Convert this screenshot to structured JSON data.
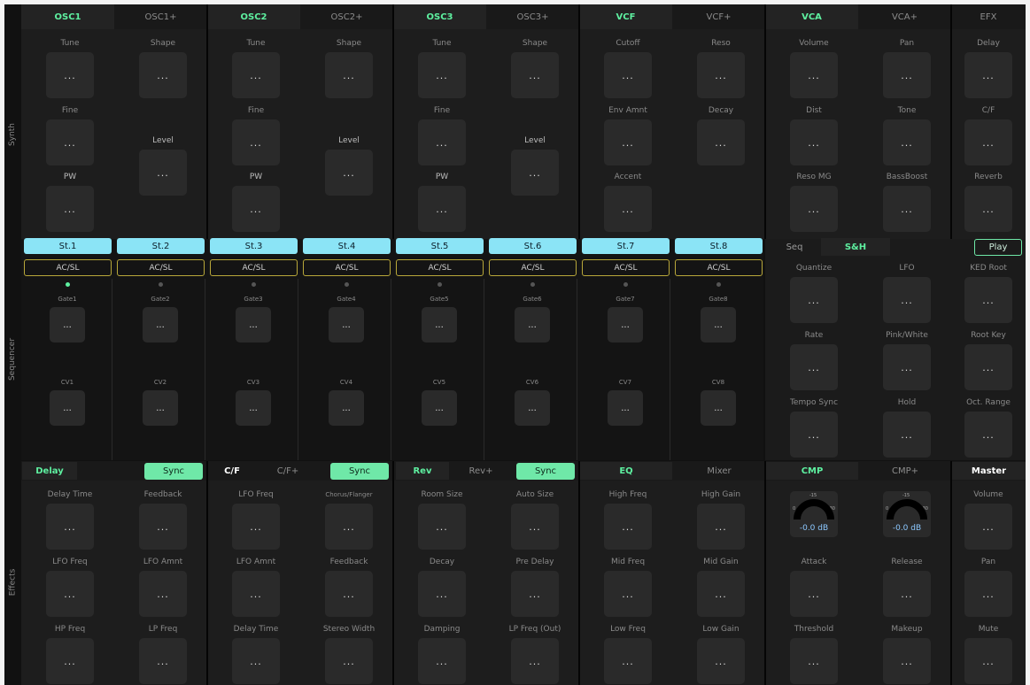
{
  "side_labels": {
    "synth": "Synth",
    "sequencer": "Sequencer",
    "effects": "Effects"
  },
  "tabs_top": [
    {
      "a": "OSC1",
      "b": "OSC1+"
    },
    {
      "a": "OSC2",
      "b": "OSC2+"
    },
    {
      "a": "OSC3",
      "b": "OSC3+"
    },
    {
      "a": "VCF",
      "b": "VCF+"
    },
    {
      "a": "VCA",
      "b": "VCA+"
    },
    {
      "a": "EFX"
    }
  ],
  "synth": {
    "osc1": {
      "k1": "Tune",
      "k2": "Shape",
      "k3": "Fine",
      "k4": "Level",
      "k5": "PW"
    },
    "osc2": {
      "k1": "Tune",
      "k2": "Shape",
      "k3": "Fine",
      "k4": "Level",
      "k5": "PW"
    },
    "osc3": {
      "k1": "Tune",
      "k2": "Shape",
      "k3": "Fine",
      "k4": "Level",
      "k5": "PW"
    },
    "vcf": {
      "k1": "Cutoff",
      "k2": "Reso",
      "k3": "Env Amnt",
      "k4": "Decay",
      "k5": "Accent"
    },
    "vca": {
      "k1": "Volume",
      "k2": "Pan",
      "k3": "Dist",
      "k4": "Tone",
      "k5": "Reso MG",
      "k6": "BassBoost"
    },
    "efx": {
      "k1": "Delay",
      "k2": "C/F",
      "k3": "Reverb"
    }
  },
  "value_placeholder": "...",
  "steps": [
    "St.1",
    "St.2",
    "St.3",
    "St.4",
    "St.5",
    "St.6",
    "St.7",
    "St.8"
  ],
  "acsl": "AC/SL",
  "gates": [
    "Gate1",
    "Gate2",
    "Gate3",
    "Gate4",
    "Gate5",
    "Gate6",
    "Gate7",
    "Gate8"
  ],
  "cvs": [
    "CV1",
    "CV2",
    "CV3",
    "CV4",
    "CV5",
    "CV6",
    "CV7",
    "CV8"
  ],
  "seq_tabs": {
    "seq": "Seq",
    "sh": "S&H",
    "play": "Play"
  },
  "sh": {
    "k1": "Quantize",
    "k2": "LFO",
    "k3": "KED Root",
    "k4": "Rate",
    "k5": "Pink/White",
    "k6": "Root Key",
    "k7": "Tempo Sync",
    "k8": "Hold",
    "k9": "Oct. Range"
  },
  "fx_tabs": {
    "delay": "Delay",
    "sync": "Sync",
    "cf": "C/F",
    "cfp": "C/F+",
    "rev": "Rev",
    "revp": "Rev+",
    "eq": "EQ",
    "mixer": "Mixer",
    "cmp": "CMP",
    "cmpp": "CMP+",
    "master": "Master"
  },
  "fx": {
    "delay": {
      "k1": "Delay Time",
      "k2": "Feedback",
      "k3": "LFO Freq",
      "k4": "LFO Amnt",
      "k5": "HP Freq",
      "k6": "LP Freq"
    },
    "cf": {
      "k1": "LFO Freq",
      "k2": "Chorus/Flanger",
      "k3": "LFO Amnt",
      "k4": "Feedback",
      "k5": "Delay Time",
      "k6": "Stereo Width"
    },
    "rev": {
      "k1": "Room Size",
      "k2": "Auto Size",
      "k3": "Decay",
      "k4": "Pre Delay",
      "k5": "Damping",
      "k6": "LP Freq (Out)"
    },
    "eq": {
      "k1": "High Freq",
      "k2": "High Gain",
      "k3": "Mid Freq",
      "k4": "Mid Gain",
      "k5": "Low Freq",
      "k6": "Low Gain"
    },
    "cmp": {
      "m1": "-0.0 dB",
      "m2": "-0.0 dB",
      "k3": "Attack",
      "k4": "Release",
      "k5": "Threshold",
      "k6": "Makeup",
      "scale_top": "-15",
      "scale_l": "0",
      "scale_r": "30"
    },
    "master": {
      "k1": "Volume",
      "k2": "Pan",
      "k3": "Mute"
    }
  },
  "colors": {
    "accent_green": "#5ef0a0",
    "step_cyan": "#8be4f6",
    "acsl_border": "#b9a83a"
  }
}
